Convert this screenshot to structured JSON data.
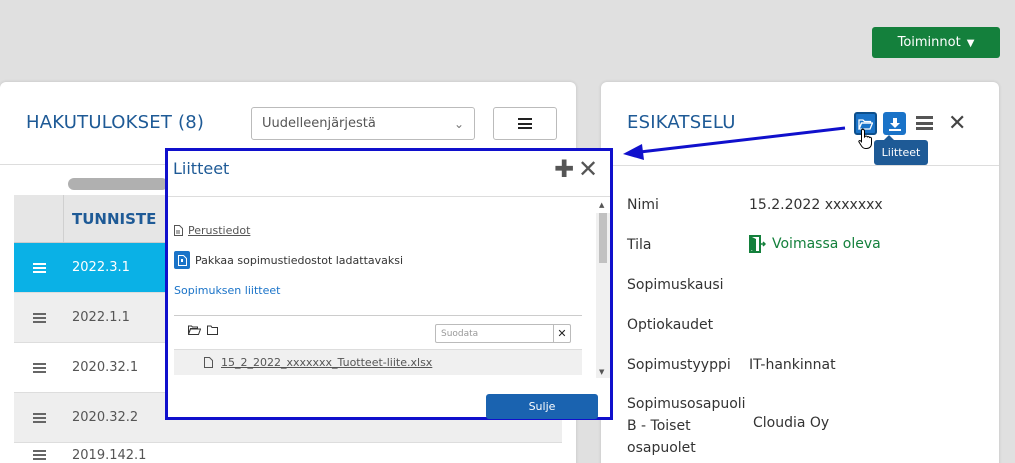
{
  "toolbar": {
    "actions_label": "Toiminnot"
  },
  "left": {
    "title": "HAKUTULOKSET (8)",
    "sort_placeholder": "Uudelleenjärjestä",
    "column_header": "TUNNISTE",
    "rows": [
      "2022.3.1",
      "2022.1.1",
      "2020.32.1",
      "2020.32.2"
    ],
    "partial_row": "2019.142.1"
  },
  "right": {
    "title": "ESIKATSELU",
    "tooltip": "Liitteet",
    "fields": {
      "name_label": "Nimi",
      "name_value": "15.2.2022 xxxxxxx",
      "status_label": "Tila",
      "status_value": "Voimassa oleva",
      "period_label": "Sopimuskausi",
      "option_label": "Optiokaudet",
      "type_label": "Sopimustyyppi",
      "type_value": "IT-hankinnat",
      "party_label_1": "Sopimusosapuoli",
      "party_label_2": "B - Toiset",
      "party_label_3": "osapuolet",
      "party_value": "Cloudia Oy"
    }
  },
  "dialog": {
    "title": "Liitteet",
    "basic_info": "Perustiedot",
    "package_text": "Pakkaa sopimustiedostot ladattavaksi",
    "attachments_link": "Sopimuksen liitteet",
    "filter_placeholder": "Suodata",
    "file_name": "15_2_2022_xxxxxxx_Tuotteet-liite.xlsx",
    "close_button": "Sulje"
  },
  "colors": {
    "primary_blue": "#1a73c8",
    "title_blue": "#1e5a96",
    "green": "#14803c",
    "selected_row": "#0ab1e6",
    "dialog_border": "#1010cc"
  }
}
